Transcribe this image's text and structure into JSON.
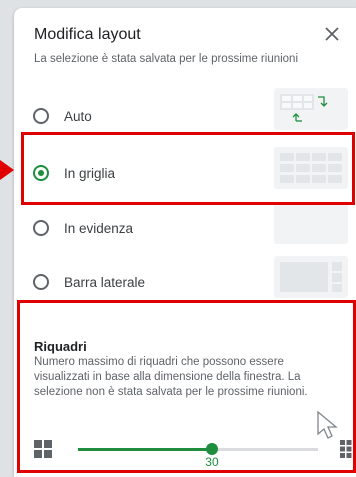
{
  "dialog": {
    "title": "Modifica layout",
    "subtitle": "La selezione è stata salvata per le prossime riunioni"
  },
  "options": [
    {
      "label": "Auto",
      "checked": false
    },
    {
      "label": "In griglia",
      "checked": true
    },
    {
      "label": "In evidenza",
      "checked": false
    },
    {
      "label": "Barra laterale",
      "checked": false
    }
  ],
  "tiles": {
    "title": "Riquadri",
    "description": "Numero massimo di riquadri che possono essere visualizzati in base alla dimensione della finestra. La selezione non è stata salvata per le prossime riunioni.",
    "value": "30",
    "min": 6,
    "max": 49,
    "current": 30
  },
  "colors": {
    "accent": "#1e8e3e",
    "highlight": "#e00000"
  },
  "icons": {
    "close": "close-icon",
    "small_grid": "grid-small-icon",
    "large_grid": "grid-large-icon"
  }
}
